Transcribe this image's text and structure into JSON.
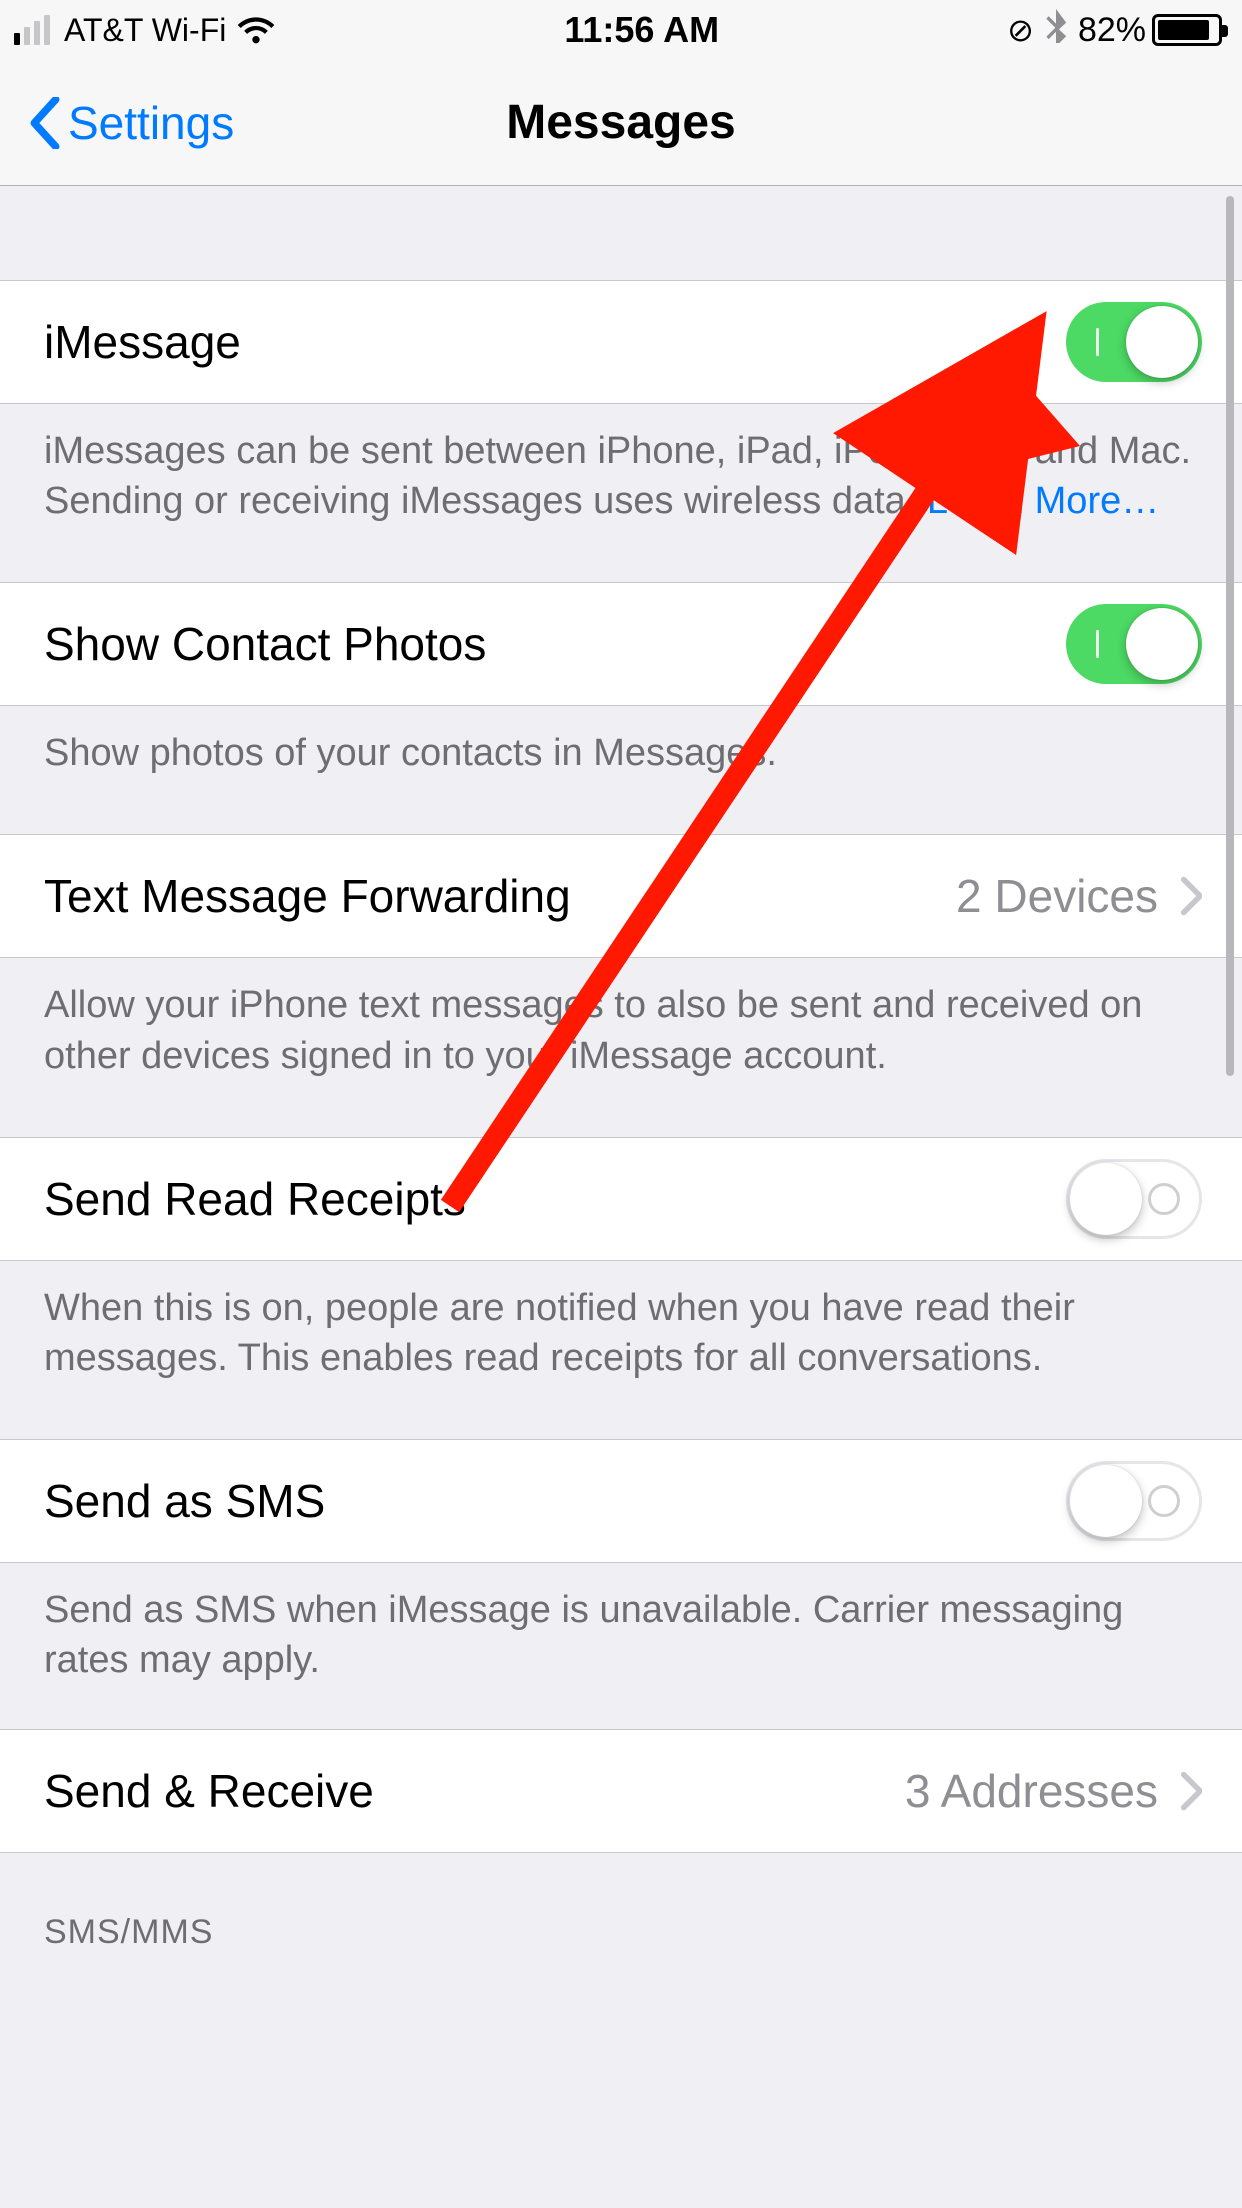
{
  "status": {
    "carrier": "AT&T Wi-Fi",
    "time": "11:56 AM",
    "orientation_lock_icon": "orientation-lock",
    "bluetooth_icon": "bluetooth",
    "battery_pct": "82%"
  },
  "nav": {
    "back_label": "Settings",
    "title": "Messages"
  },
  "rows": {
    "imessage": {
      "label": "iMessage",
      "on": true
    },
    "imessage_footer": "iMessages can be sent between iPhone, iPad, iPod touch, and Mac. Sending or receiving iMessages uses wireless data.",
    "imessage_learn_more": "Learn More…",
    "show_contact_photos": {
      "label": "Show Contact Photos",
      "on": true
    },
    "show_contact_photos_footer": "Show photos of your contacts in Messages.",
    "text_forwarding": {
      "label": "Text Message Forwarding",
      "value": "2 Devices"
    },
    "text_forwarding_footer": "Allow your iPhone text messages to also be sent and received on other devices signed in to your iMessage account.",
    "read_receipts": {
      "label": "Send Read Receipts",
      "on": false
    },
    "read_receipts_footer": "When this is on, people are notified when you have read their messages. This enables read receipts for all conversations.",
    "send_as_sms": {
      "label": "Send as SMS",
      "on": false
    },
    "send_as_sms_footer": "Send as SMS when iMessage is unavailable. Carrier messaging rates may apply.",
    "send_receive": {
      "label": "Send & Receive",
      "value": "3 Addresses"
    }
  },
  "section_header_smsmms": "SMS/MMS"
}
